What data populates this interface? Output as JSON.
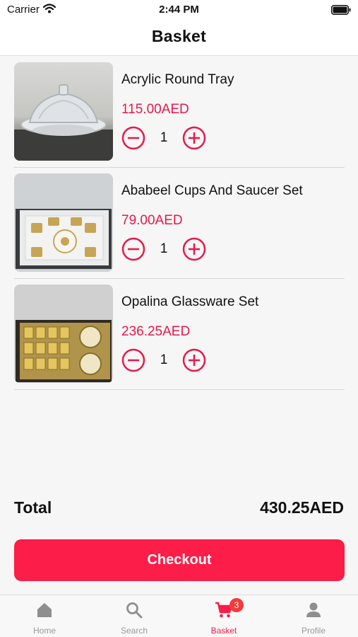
{
  "status_bar": {
    "carrier": "Carrier",
    "time": "2:44 PM"
  },
  "header": {
    "title": "Basket"
  },
  "basket": {
    "items": [
      {
        "name": "Acrylic Round Tray",
        "price": "115.00AED",
        "quantity": "1"
      },
      {
        "name": "Ababeel Cups And Saucer Set",
        "price": "79.00AED",
        "quantity": "1"
      },
      {
        "name": "Opalina Glassware Set",
        "price": "236.25AED",
        "quantity": "1"
      }
    ]
  },
  "summary": {
    "total_label": "Total",
    "total_value": "430.25AED"
  },
  "checkout": {
    "label": "Checkout"
  },
  "tab_bar": {
    "tabs": [
      {
        "label": "Home",
        "icon": "home-icon"
      },
      {
        "label": "Search",
        "icon": "search-icon"
      },
      {
        "label": "Basket",
        "icon": "cart-icon",
        "badge": "3",
        "active": true
      },
      {
        "label": "Profile",
        "icon": "profile-icon"
      }
    ]
  },
  "colors": {
    "accent": "#fc1d48",
    "price": "#e8184a",
    "badge": "#f33b3b",
    "inactive": "#999999"
  }
}
